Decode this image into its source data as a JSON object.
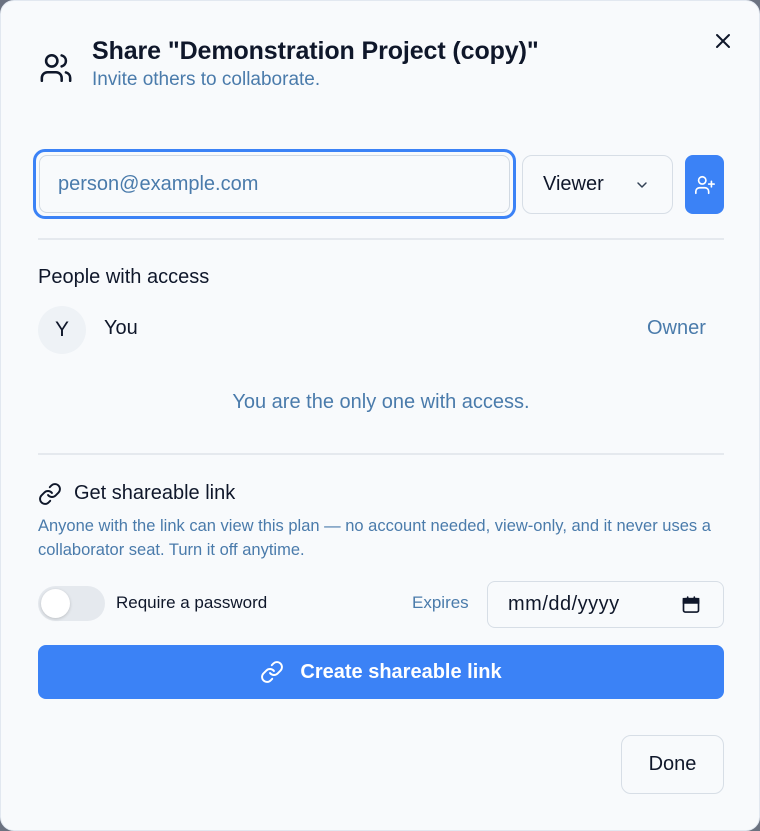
{
  "dialog": {
    "title": "Share \"Demonstration Project (copy)\"",
    "subtitle": "Invite others to collaborate.",
    "header_icon": "users-icon",
    "close_icon": "close-icon"
  },
  "invite": {
    "email_placeholder": "person@example.com",
    "email_value": "",
    "role_selected": "Viewer",
    "add_icon": "user-plus-icon"
  },
  "access": {
    "heading": "People with access",
    "people": [
      {
        "initial": "Y",
        "name": "You",
        "role": "Owner"
      }
    ],
    "note": "You are the only one with access."
  },
  "share_link": {
    "heading": "Get shareable link",
    "description": "Anyone with the link can view this plan — no account needed, view-only, and it never uses a collaborator seat. Turn it off anytime.",
    "password_label": "Require a password",
    "password_enabled": false,
    "expires_label": "Expires",
    "date_placeholder": "mm/dd/yyyy",
    "create_button": "Create shareable link"
  },
  "footer": {
    "done_button": "Done"
  },
  "colors": {
    "accent": "#3b82f6",
    "muted_text": "#4a7bab",
    "background": "#f8fafc"
  }
}
